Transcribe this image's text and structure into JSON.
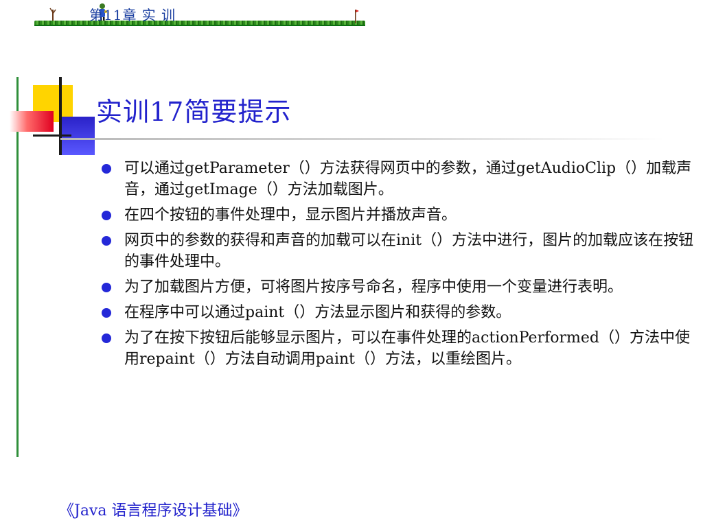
{
  "header": {
    "chapter_title": "第11章  实 训"
  },
  "slide": {
    "title": "实训17简要提示",
    "bullets": [
      "可以通过getParameter（）方法获得网页中的参数，通过getAudioClip（）加载声音，通过getImage（）方法加载图片。",
      "在四个按钮的事件处理中，显示图片并播放声音。",
      "网页中的参数的获得和声音的加载可以在init（）方法中进行，图片的加载应该在按钮的事件处理中。",
      "为了加载图片方便，可将图片按序号命名，程序中使用一个变量进行表明。",
      "在程序中可以通过paint（）方法显示图片和获得的参数。",
      "为了在按下按钮后能够显示图片，可以在事件处理的actionPerformed（）方法中使用repaint（）方法自动调用paint（）方法，以重绘图片。"
    ]
  },
  "footer": {
    "book_title": "《Java 语言程序设计基础》"
  },
  "colors": {
    "title_blue": "#2222cc",
    "bullet_blue": "#2428d8",
    "rule_green": "#2f8f3a",
    "deco_yellow": "#ffd400",
    "deco_red": "#e00020",
    "deco_blue": "#2a22c8"
  }
}
